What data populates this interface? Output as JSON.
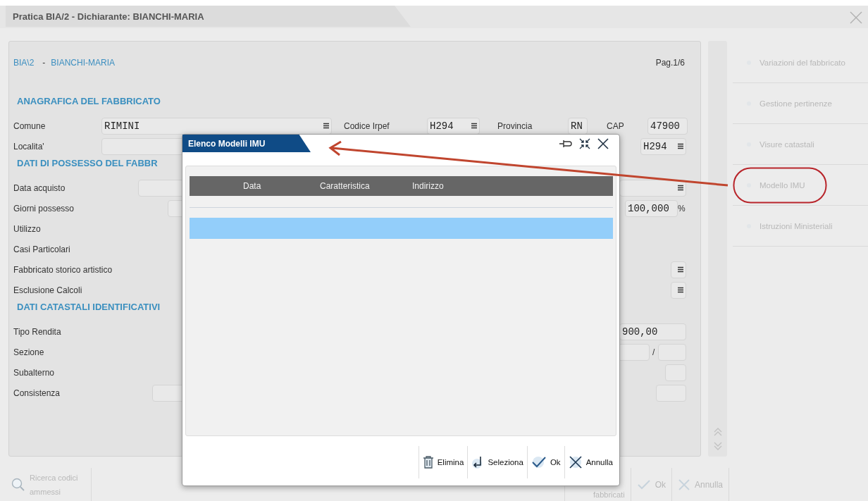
{
  "window": {
    "title": "Pratica BIA/2 - Dichiarante: BIANCHI-MARIA"
  },
  "header": {
    "code": "BIA\\2",
    "separator": "-",
    "name": "BIANCHI-MARIA",
    "page": "Pag.1/6"
  },
  "sections": [
    {
      "title": "ANAGRAFICA DEL FABBRICATO",
      "rows": [
        {
          "label": "Comune",
          "items": [
            {
              "kind": "field",
              "value": "RIMINI",
              "lookup": true
            },
            {
              "kind": "text",
              "text": "Codice Irpef"
            },
            {
              "kind": "field",
              "value": "H294",
              "lookup": true
            },
            {
              "kind": "text",
              "text": "Provincia"
            },
            {
              "kind": "field",
              "value": "RN"
            },
            {
              "kind": "text",
              "text": "CAP"
            },
            {
              "kind": "field",
              "value": "47900"
            }
          ]
        },
        {
          "label": "Localita'",
          "items": [
            {
              "kind": "field"
            },
            {
              "kind": "field",
              "value": "H294",
              "lookup": true
            }
          ]
        }
      ]
    },
    {
      "title": "DATI DI POSSESSO DEL FABBR",
      "rows": [
        {
          "label": "Data acquisto",
          "items": [
            {
              "kind": "field"
            },
            {
              "kind": "field",
              "lookup": true
            }
          ]
        },
        {
          "label": "Giorni possesso",
          "items": [
            {
              "kind": "field"
            },
            {
              "kind": "field",
              "value": "100,000"
            },
            {
              "kind": "text",
              "text": "%"
            }
          ]
        },
        {
          "label": "Utilizzo",
          "items": []
        },
        {
          "label": "Casi Particolari",
          "items": []
        },
        {
          "label": "Fabbricato storico artistico",
          "items": [
            {
              "kind": "field",
              "lookup": true
            }
          ]
        },
        {
          "label": "Esclusione Calcoli",
          "items": [
            {
              "kind": "field",
              "lookup": true
            }
          ]
        }
      ]
    },
    {
      "title": "DATI CATASTALI IDENTIFICATIVI",
      "rows": [
        {
          "label": "Tipo Rendita",
          "items": [
            {
              "kind": "field",
              "value": "900,00"
            }
          ]
        },
        {
          "label": "Sezione",
          "items": [
            {
              "kind": "field"
            },
            {
              "kind": "text",
              "text": "/"
            },
            {
              "kind": "field"
            }
          ]
        },
        {
          "label": "Subalterno",
          "items": [
            {
              "kind": "field"
            }
          ]
        },
        {
          "label": "Consistenza",
          "items": [
            {
              "kind": "field"
            },
            {
              "kind": "field"
            }
          ]
        }
      ]
    }
  ],
  "sidebar": {
    "items": [
      {
        "label": "Variazioni del fabbricato"
      },
      {
        "label": "Gestione pertinenze"
      },
      {
        "label": "Visure catastali"
      },
      {
        "label": "Modello IMU",
        "highlighted": true
      },
      {
        "label": "Istruzioni Ministeriali"
      }
    ]
  },
  "bottom_bar": {
    "buttons": [
      {
        "kind": "search",
        "label": "Ricerca codici ammessi"
      },
      {
        "kind": "partial",
        "label": "fabbricati"
      },
      {
        "kind": "ok",
        "label": "Ok"
      },
      {
        "kind": "cancel",
        "label": "Annulla"
      }
    ]
  },
  "dialog": {
    "title": "Elenco Modelli IMU",
    "table": {
      "columns": [
        "Data",
        "Caratteristica",
        "Indirizzo"
      ],
      "rows": [
        {
          "selected": true
        }
      ]
    },
    "buttons": [
      {
        "kind": "delete",
        "label": "Elimina"
      },
      {
        "kind": "select",
        "label": "Seleziona"
      },
      {
        "kind": "ok",
        "label": "Ok"
      },
      {
        "kind": "cancel",
        "label": "Annulla"
      }
    ]
  }
}
